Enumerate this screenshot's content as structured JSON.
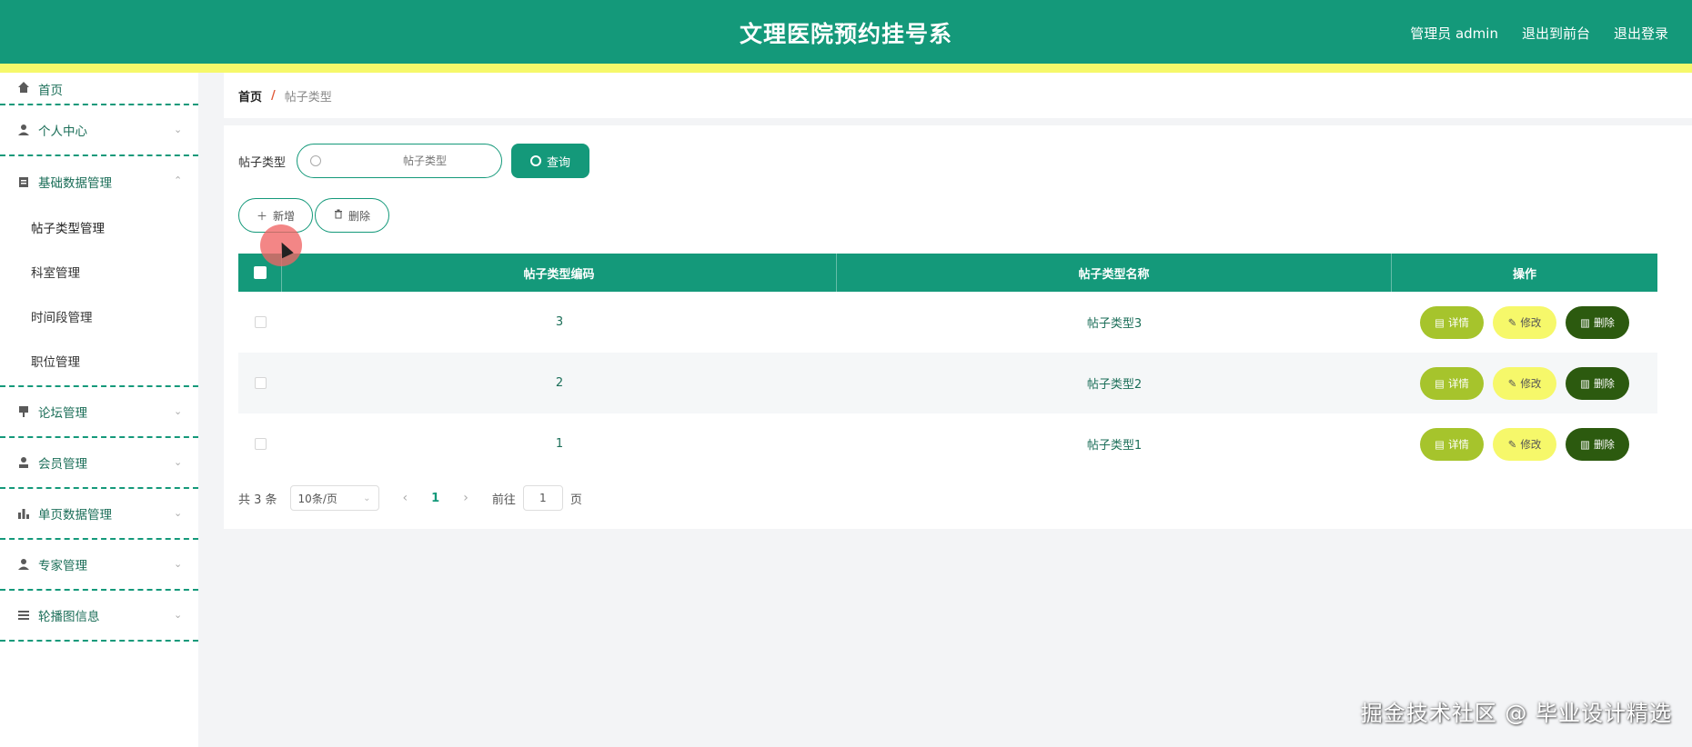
{
  "header": {
    "title": "文理医院预约挂号系",
    "admin_label": "管理员 admin",
    "to_front": "退出到前台",
    "logout": "退出登录"
  },
  "sidebar": {
    "home": "首页",
    "personal": "个人中心",
    "base_data": "基础数据管理",
    "sub_items": [
      "帖子类型管理",
      "科室管理",
      "时间段管理",
      "职位管理"
    ],
    "forum": "论坛管理",
    "member": "会员管理",
    "single_page": "单页数据管理",
    "expert": "专家管理",
    "carousel": "轮播图信息"
  },
  "breadcrumb": {
    "home": "首页",
    "sep": "/",
    "current": "帖子类型"
  },
  "search": {
    "label": "帖子类型",
    "placeholder": "帖子类型",
    "query_button": "查询"
  },
  "actions": {
    "add": "新增",
    "delete": "删除"
  },
  "table": {
    "headers": [
      "帖子类型编码",
      "帖子类型名称",
      "操作"
    ],
    "rows": [
      {
        "code": "3",
        "name": "帖子类型3"
      },
      {
        "code": "2",
        "name": "帖子类型2"
      },
      {
        "code": "1",
        "name": "帖子类型1"
      }
    ],
    "row_ops": {
      "detail": "详情",
      "edit": "修改",
      "delete": "删除"
    }
  },
  "pagination": {
    "total": "共 3 条",
    "page_size": "10条/页",
    "current_page": "1",
    "goto_label": "前往",
    "goto_value": "1",
    "page_unit": "页"
  },
  "watermark": "掘金技术社区 @ 毕业设计精选",
  "colors": {
    "primary": "#14997a",
    "accent_yellow": "#f6f86a",
    "detail": "#a6c42c",
    "danger": "#2c5a0f"
  }
}
